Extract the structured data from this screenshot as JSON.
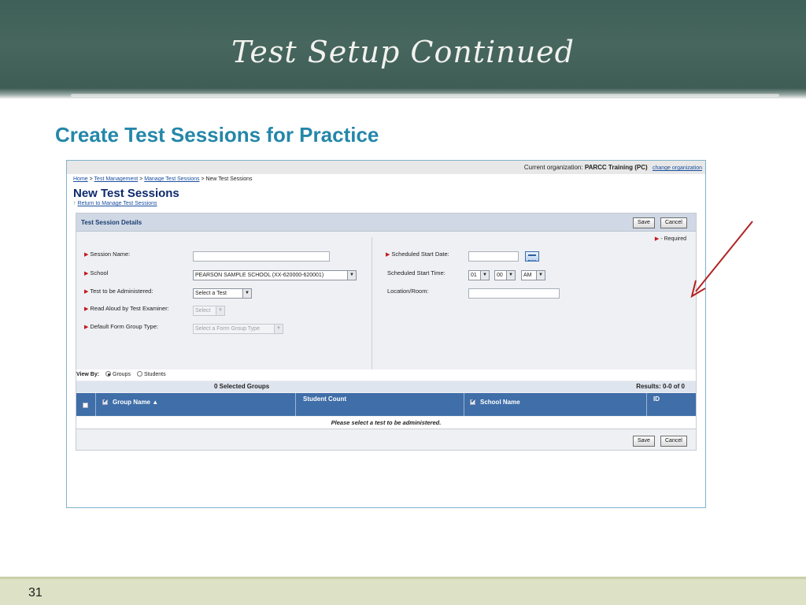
{
  "slide": {
    "title": "Test Setup Continued",
    "subtitle": "Create Test Sessions for Practice",
    "page_number": "31"
  },
  "app": {
    "org_label": "Current organization:",
    "org_name": "PARCC Training (PC)",
    "change_org_link": "change organization",
    "breadcrumb": {
      "home": "Home",
      "sep1": " > ",
      "test_mgmt": "Test Management",
      "sep2": " > ",
      "manage_sessions": "Manage Test Sessions",
      "sep3": " > ",
      "current": "New Test Sessions"
    },
    "page_title": "New Test Sessions",
    "back_link": "Return to Manage Test Sessions",
    "panel": {
      "title": "Test Session Details",
      "save_label": "Save",
      "cancel_label": "Cancel",
      "required_note": "- Required",
      "fields": {
        "session_name": {
          "label": "Session Name:",
          "value": ""
        },
        "school": {
          "label": "School",
          "value": "PEARSON SAMPLE SCHOOL (XX-620000-620001)"
        },
        "test": {
          "label": "Test to be Administered:",
          "value": "Select a Test"
        },
        "read_aloud": {
          "label": "Read Aloud by Test Examiner:",
          "value": "Select"
        },
        "form_group": {
          "label": "Default Form Group Type:",
          "value": "Select a Form Group Type"
        },
        "start_date": {
          "label": "Scheduled Start Date:",
          "value": ""
        },
        "start_time": {
          "label": "Scheduled Start Time:",
          "hour": "01",
          "minute": "00",
          "ampm": "AM"
        },
        "location": {
          "label": "Location/Room:",
          "value": ""
        }
      },
      "view_by": {
        "label": "View By:",
        "options": [
          "Groups",
          "Students"
        ],
        "selected": "Groups"
      },
      "grid": {
        "selected_count": "0 Selected Groups",
        "results": "Results: 0-0 of 0",
        "columns": [
          "Group Name ▲",
          "Student Count",
          "School Name",
          "ID"
        ],
        "empty_message": "Please select a test to be administered."
      }
    }
  },
  "colors": {
    "board": "#46665e",
    "subtitle": "#2487a9",
    "grid_header": "#3f6ea8",
    "arrow": "#b22222"
  }
}
